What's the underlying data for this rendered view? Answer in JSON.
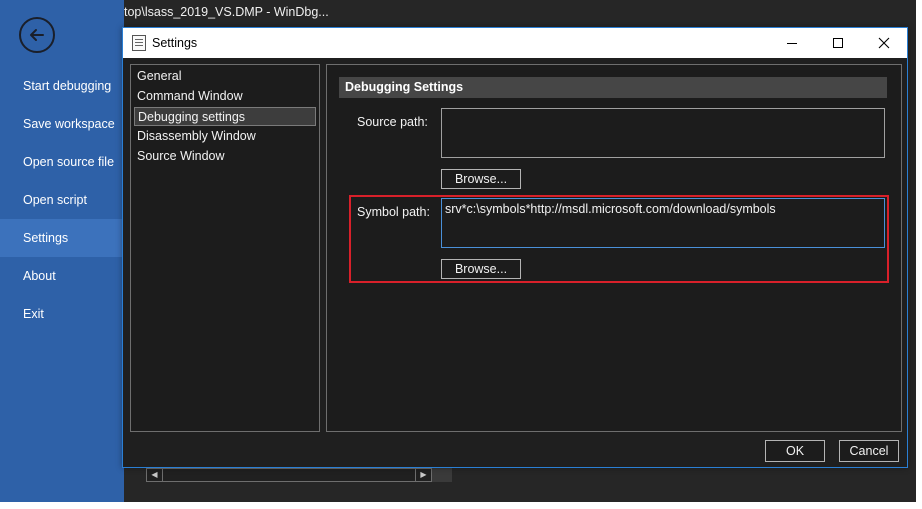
{
  "window": {
    "title_fragment": "top\\lsass_2019_VS.DMP - WinDbg..."
  },
  "backstage": {
    "items": [
      {
        "label": "Start debugging"
      },
      {
        "label": "Save workspace"
      },
      {
        "label": "Open source file"
      },
      {
        "label": "Open script"
      },
      {
        "label": "Settings",
        "selected": true
      },
      {
        "label": "About"
      },
      {
        "label": "Exit"
      }
    ],
    "back_icon": "back-arrow-circle-icon"
  },
  "dialog": {
    "title": "Settings",
    "icon": "settings-document-icon",
    "controls": {
      "minimize_icon": "minimize-icon",
      "maximize_icon": "maximize-icon",
      "close_icon": "close-icon"
    },
    "tree": [
      {
        "label": "General"
      },
      {
        "label": "Command Window"
      },
      {
        "label": "Debugging settings",
        "selected": true
      },
      {
        "label": "Disassembly Window"
      },
      {
        "label": "Source Window"
      }
    ],
    "section_title": "Debugging Settings",
    "source_path": {
      "label": "Source path:",
      "value": "",
      "browse_label": "Browse..."
    },
    "symbol_path": {
      "label": "Symbol path:",
      "value": "srv*c:\\symbols*http://msdl.microsoft.com/download/symbols",
      "browse_label": "Browse..."
    },
    "footer": {
      "ok_label": "OK",
      "cancel_label": "Cancel"
    }
  },
  "colors": {
    "backstage_bg": "#2e61a8",
    "backstage_selected": "#3c72bc",
    "dialog_accent": "#2a7fd4",
    "highlight_red": "#d8202a"
  }
}
